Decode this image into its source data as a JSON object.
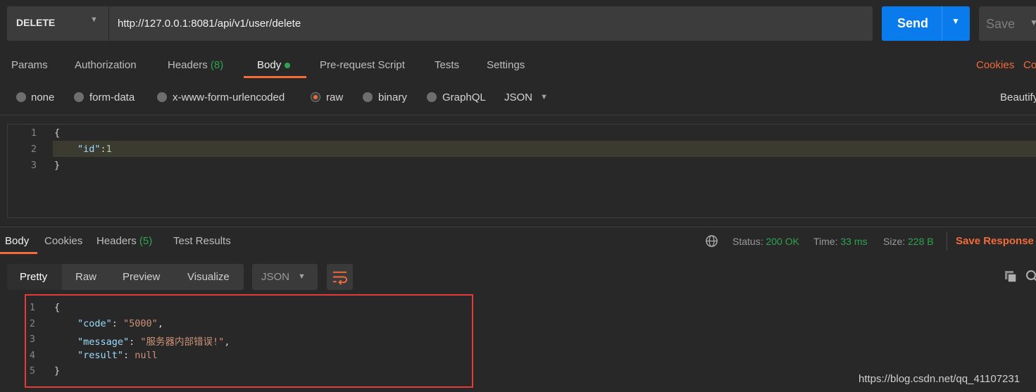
{
  "request": {
    "method": "DELETE",
    "url": "http://127.0.0.1:8081/api/v1/user/delete",
    "send_label": "Send",
    "save_label": "Save"
  },
  "request_tabs": {
    "params": "Params",
    "authorization": "Authorization",
    "headers": "Headers",
    "headers_count": "(8)",
    "body": "Body",
    "prerequest": "Pre-request Script",
    "tests": "Tests",
    "settings": "Settings",
    "cookies": "Cookies",
    "code_partial": "Co"
  },
  "body_modes": {
    "none": "none",
    "form_data": "form-data",
    "urlencoded": "x-www-form-urlencoded",
    "raw": "raw",
    "binary": "binary",
    "graphql": "GraphQL",
    "format": "JSON",
    "beautify": "Beautify"
  },
  "request_body": {
    "line_numbers": [
      "1",
      "2",
      "3"
    ],
    "open_brace": "{",
    "key": "\"id\"",
    "colon": ":",
    "value": "1",
    "close_brace": "}"
  },
  "response_tabs": {
    "body": "Body",
    "cookies": "Cookies",
    "headers": "Headers",
    "headers_count": "(5)",
    "test_results": "Test Results"
  },
  "response_meta": {
    "status_label": "Status:",
    "status_value": "200 OK",
    "time_label": "Time:",
    "time_value": "33 ms",
    "size_label": "Size:",
    "size_value": "228 B",
    "save_response": "Save Response"
  },
  "response_view": {
    "pretty": "Pretty",
    "raw": "Raw",
    "preview": "Preview",
    "visualize": "Visualize",
    "format": "JSON"
  },
  "response_body": {
    "line_numbers": [
      "1",
      "2",
      "3",
      "4",
      "5"
    ],
    "open_brace": "{",
    "code_key": "\"code\"",
    "code_value": "\"5000\"",
    "message_key": "\"message\"",
    "message_value": "\"服务器内部错误!\"",
    "result_key": "\"result\"",
    "result_value": "null",
    "close_brace": "}"
  },
  "watermark": "https://blog.csdn.net/qq_41107231",
  "colors": {
    "accent": "#f26b3a",
    "send_blue": "#097bed",
    "success_green": "#2fa44f",
    "highlight_red": "#e23b3b"
  }
}
